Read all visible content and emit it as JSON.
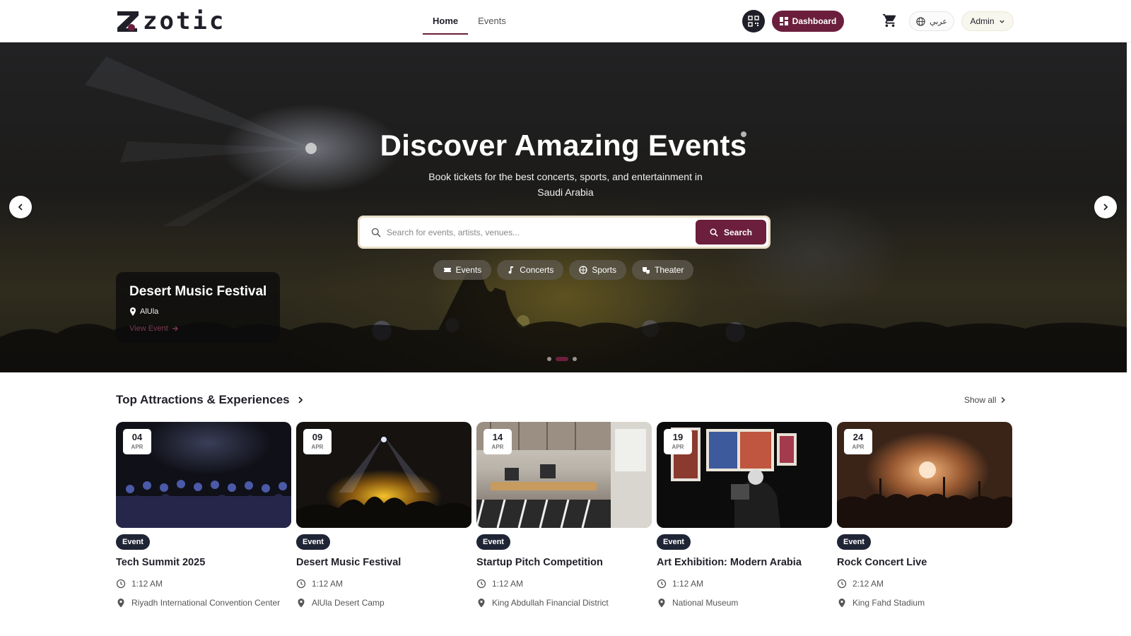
{
  "brand": {
    "name": "zotic",
    "accent": "#6b1f3c",
    "dark": "#1f1f29"
  },
  "nav": {
    "items": [
      {
        "label": "Home",
        "active": true
      },
      {
        "label": "Events",
        "active": false
      }
    ]
  },
  "header": {
    "qr_icon": "qr-scan-icon",
    "dashboard_label": "Dashboard",
    "cart_icon": "cart-icon",
    "language_label": "عربي",
    "user_label": "Admin"
  },
  "hero": {
    "title": "Discover Amazing Events",
    "subtitle": "Book tickets for the best concerts, sports, and entertainment in Saudi Arabia",
    "search": {
      "placeholder": "Search for events, artists, venues...",
      "value": "",
      "button_label": "Search"
    },
    "categories": [
      {
        "label": "Events",
        "icon": "ticket-icon"
      },
      {
        "label": "Concerts",
        "icon": "music-note-icon"
      },
      {
        "label": "Sports",
        "icon": "ball-icon"
      },
      {
        "label": "Theater",
        "icon": "theater-icon"
      }
    ],
    "featured": {
      "title": "Desert Music Festival",
      "location": "AlUla",
      "link_label": "View Event"
    },
    "slides": {
      "count": 3,
      "active_index": 1
    }
  },
  "section": {
    "title": "Top Attractions & Experiences",
    "show_all_label": "Show all",
    "events": [
      {
        "day": "04",
        "month": "APR",
        "badge": "Event",
        "title": "Tech Summit 2025",
        "time": "1:12 AM",
        "venue": "Riyadh International Convention Center"
      },
      {
        "day": "09",
        "month": "APR",
        "badge": "Event",
        "title": "Desert Music Festival",
        "time": "1:12 AM",
        "venue": "AlUla Desert Camp"
      },
      {
        "day": "14",
        "month": "APR",
        "badge": "Event",
        "title": "Startup Pitch Competition",
        "time": "1:12 AM",
        "venue": "King Abdullah Financial District"
      },
      {
        "day": "19",
        "month": "APR",
        "badge": "Event",
        "title": "Art Exhibition: Modern Arabia",
        "time": "1:12 AM",
        "venue": "National Museum"
      },
      {
        "day": "24",
        "month": "APR",
        "badge": "Event",
        "title": "Rock Concert Live",
        "time": "2:12 AM",
        "venue": "King Fahd Stadium"
      }
    ]
  }
}
